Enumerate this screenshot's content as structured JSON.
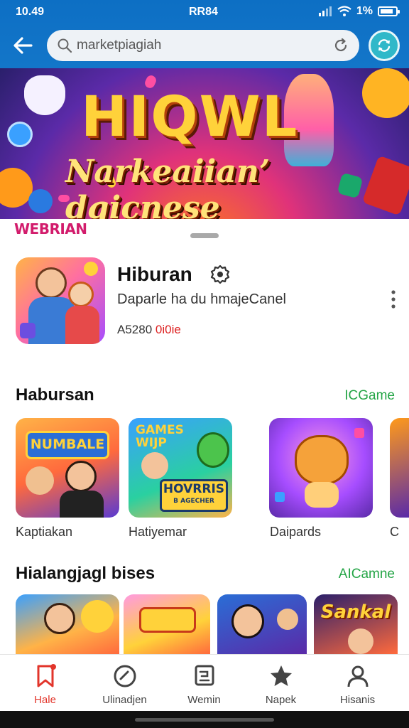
{
  "status_bar": {
    "time": "10.49",
    "carrier": "RR84",
    "battery_text": "1%"
  },
  "search": {
    "placeholder": "marketpiagiah"
  },
  "banner": {
    "title": "HIQWL",
    "subtitle": "Narkeaiian’ dqicnese"
  },
  "pink_label": "WEBRIAN",
  "app": {
    "name": "Hiburan",
    "description": "Daparle ha du hmajeCanel",
    "meta_left": "A5280",
    "meta_right": "0i0ie"
  },
  "sections": [
    {
      "title": "Habursan",
      "link": "ICGame",
      "tiles": [
        {
          "art": "NUMBALE",
          "label": "Kaptiakan"
        },
        {
          "art": "HOVRRIS",
          "label": "Hatiyemar"
        },
        {
          "art": "",
          "label": "Daipards"
        },
        {
          "art": "",
          "label": "C"
        }
      ]
    },
    {
      "title": "Hialangjagl bises",
      "link": "AICamne",
      "tiles": [
        {
          "art": ""
        },
        {
          "art": ""
        },
        {
          "art": ""
        },
        {
          "art": "Sankal"
        }
      ]
    }
  ],
  "tile_extra": {
    "games_art": "GAMES WIJP",
    "bagtext": "B AGECHER"
  },
  "nav": [
    {
      "label": "Hale",
      "icon": "bookmark-icon",
      "active": true
    },
    {
      "label": "Ulinadjen",
      "icon": "circle-icon",
      "active": false
    },
    {
      "label": "Wemin",
      "icon": "document-icon",
      "active": false
    },
    {
      "label": "Napek",
      "icon": "star-icon",
      "active": false
    },
    {
      "label": "Hisanis",
      "icon": "profile-icon",
      "active": false
    }
  ],
  "colors": {
    "top_bar": "#1376c9",
    "accent_link": "#24a546",
    "nav_active": "#e2352b",
    "pink_label": "#d21c6c"
  }
}
